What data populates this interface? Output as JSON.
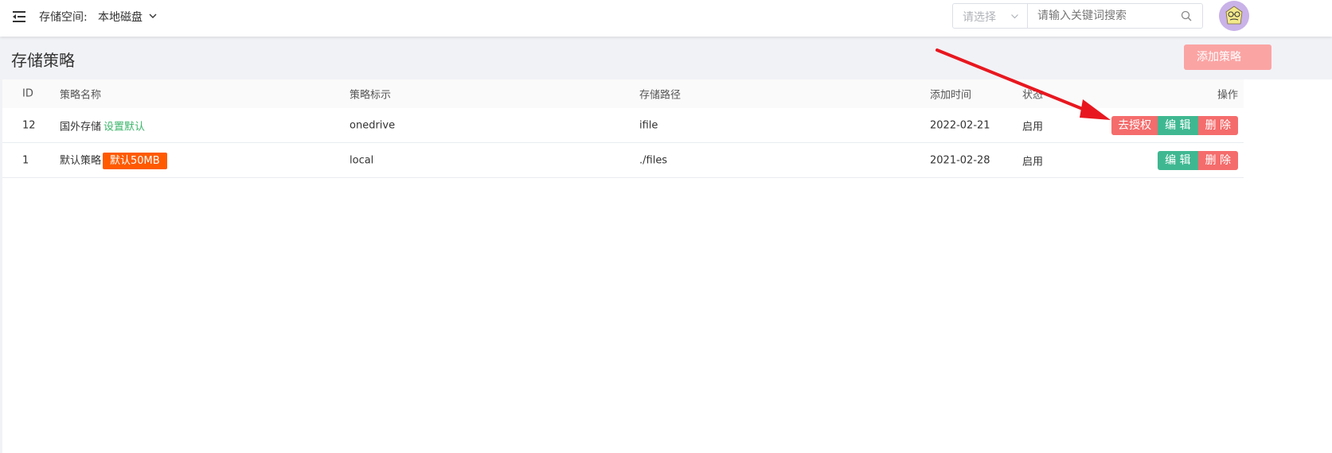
{
  "header": {
    "storage_label": "存储空间:",
    "storage_value": "本地磁盘",
    "select_placeholder": "请选择",
    "search_placeholder": "请输入关键词搜索"
  },
  "page": {
    "title": "存储策略",
    "add_button": "添加策略"
  },
  "table": {
    "columns": {
      "id": "ID",
      "name": "策略名称",
      "mark": "策略标示",
      "path": "存储路径",
      "time": "添加时间",
      "status": "状态",
      "ops": "操作"
    },
    "rows": [
      {
        "id": "12",
        "name": "国外存储",
        "extra_link": "设置默认",
        "mark": "onedrive",
        "path": "ifile",
        "time": "2022-02-21",
        "status": "启用",
        "auth_label": "去授权",
        "edit_label": "编 辑",
        "delete_label": "删 除"
      },
      {
        "id": "1",
        "name": "默认策略",
        "badge": "默认50MB",
        "mark": "local",
        "path": "./files",
        "time": "2021-02-28",
        "status": "启用",
        "edit_label": "编 辑",
        "delete_label": "删 除"
      }
    ]
  },
  "colors": {
    "danger": "#f56c6c",
    "success": "#3fb891",
    "badge": "#ff5a00",
    "link": "#3bb56b",
    "annotation": "#e8171f"
  },
  "icons": [
    "menu-fold-icon",
    "chevron-down-icon",
    "search-icon",
    "avatar-icon"
  ]
}
